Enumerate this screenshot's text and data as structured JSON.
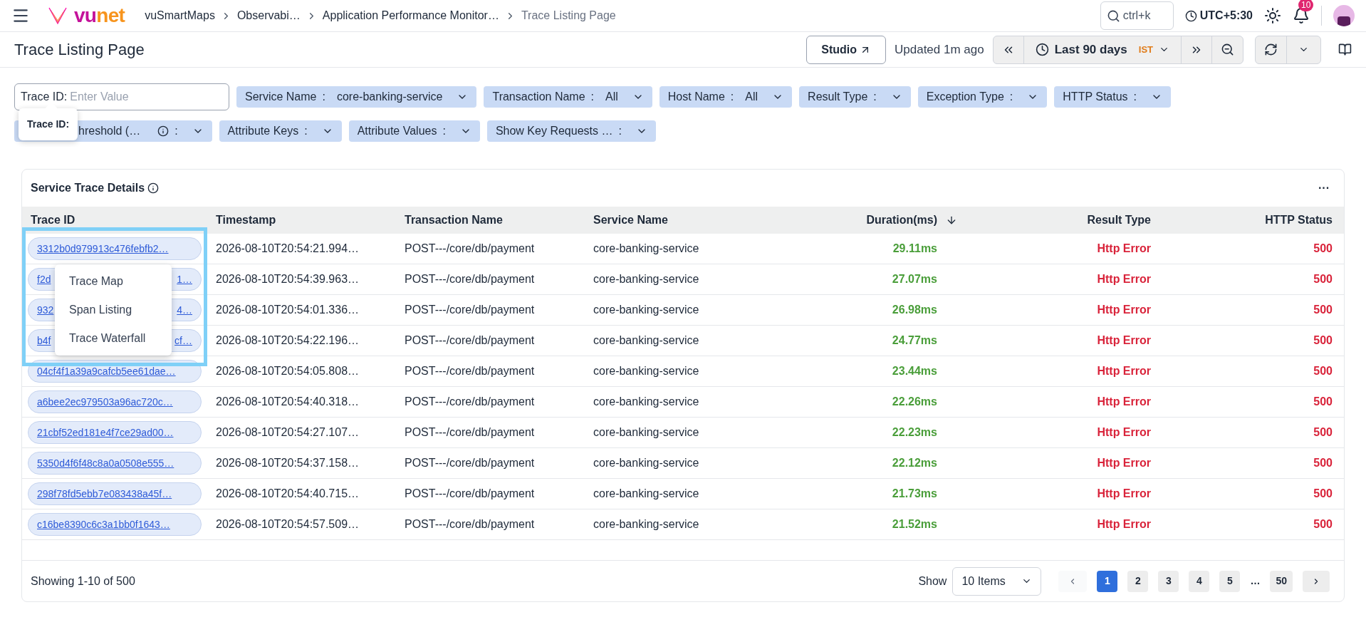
{
  "topbar": {
    "logo": {
      "first": "vu",
      "second": "net"
    },
    "breadcrumbs": [
      {
        "label": "vuSmartMaps",
        "current": false
      },
      {
        "label": "Observabi…",
        "current": false
      },
      {
        "label": "Application Performance Monitor…",
        "current": false
      },
      {
        "label": "Trace Listing Page",
        "current": true
      }
    ],
    "search": {
      "placeholder": "ctrl+k"
    },
    "timezone": "UTC+5:30",
    "notifications": "10"
  },
  "header": {
    "title": "Trace Listing Page",
    "studio": "Studio",
    "updated": "Updated 1m ago",
    "range": "Last 90 days",
    "range_zone": "IST"
  },
  "filters": [
    [
      {
        "kind": "input",
        "label": "Trace ID:",
        "placeholder": "Enter Value"
      },
      {
        "kind": "select",
        "label": "Service Name",
        "separator": ":",
        "value": "core-banking-service"
      },
      {
        "kind": "select",
        "label": "Transaction Name",
        "separator": ":",
        "value": "All"
      },
      {
        "kind": "select",
        "label": "Host Name",
        "separator": ":",
        "value": "All"
      },
      {
        "kind": "select",
        "label": "Result Type",
        "separator": ":"
      },
      {
        "kind": "select",
        "label": "Exception Type",
        "separator": ":"
      },
      {
        "kind": "select",
        "label": "HTTP Status",
        "separator": ":"
      }
    ],
    [
      {
        "kind": "info",
        "label": "hreshold (…",
        "separator": ":"
      },
      {
        "kind": "select",
        "label": "Attribute Keys",
        "separator": ":"
      },
      {
        "kind": "select",
        "label": "Attribute Values",
        "separator": ":"
      },
      {
        "kind": "select",
        "label": "Show Key Requests …",
        "separator": ":"
      }
    ]
  ],
  "tooltip": "Trace ID:",
  "card": {
    "title": "Service Trace Details",
    "more": "···",
    "columns": [
      "Trace ID",
      "Timestamp",
      "Transaction Name",
      "Service Name",
      "Duration(ms)",
      "Result Type",
      "HTTP Status"
    ],
    "rows": [
      {
        "trace_id": "3312b0d979913c476febfb2…",
        "timestamp": "2026-08-10T20:54:21.994…",
        "transaction": "POST---/core/db/payment",
        "service": "core-banking-service",
        "duration": "29.11ms",
        "result": "Http Error",
        "status": "500"
      },
      {
        "trace_id": "f2d",
        "trace_id_end": "1…",
        "timestamp": "2026-08-10T20:54:39.963…",
        "transaction": "POST---/core/db/payment",
        "service": "core-banking-service",
        "duration": "27.07ms",
        "result": "Http Error",
        "status": "500"
      },
      {
        "trace_id": "932",
        "trace_id_end": "4…",
        "timestamp": "2026-08-10T20:54:01.336…",
        "transaction": "POST---/core/db/payment",
        "service": "core-banking-service",
        "duration": "26.98ms",
        "result": "Http Error",
        "status": "500"
      },
      {
        "trace_id": "b4f",
        "trace_id_end": "cf…",
        "timestamp": "2026-08-10T20:54:22.196…",
        "transaction": "POST---/core/db/payment",
        "service": "core-banking-service",
        "duration": "24.77ms",
        "result": "Http Error",
        "status": "500"
      },
      {
        "trace_id": "04cf4f1a39a9cafcb5ee61dae…",
        "timestamp": "2026-08-10T20:54:05.808…",
        "transaction": "POST---/core/db/payment",
        "service": "core-banking-service",
        "duration": "23.44ms",
        "result": "Http Error",
        "status": "500"
      },
      {
        "trace_id": "a6bee2ec979503a96ac720c…",
        "timestamp": "2026-08-10T20:54:40.318…",
        "transaction": "POST---/core/db/payment",
        "service": "core-banking-service",
        "duration": "22.26ms",
        "result": "Http Error",
        "status": "500"
      },
      {
        "trace_id": "21cbf52ed181e4f7ce29ad00…",
        "timestamp": "2026-08-10T20:54:27.107…",
        "transaction": "POST---/core/db/payment",
        "service": "core-banking-service",
        "duration": "22.23ms",
        "result": "Http Error",
        "status": "500"
      },
      {
        "trace_id": "5350d4f6f48c8a0a0508e555…",
        "timestamp": "2026-08-10T20:54:37.158…",
        "transaction": "POST---/core/db/payment",
        "service": "core-banking-service",
        "duration": "22.12ms",
        "result": "Http Error",
        "status": "500"
      },
      {
        "trace_id": "298f78fd5ebb7e083438a45f…",
        "timestamp": "2026-08-10T20:54:40.715…",
        "transaction": "POST---/core/db/payment",
        "service": "core-banking-service",
        "duration": "21.73ms",
        "result": "Http Error",
        "status": "500"
      },
      {
        "trace_id": "c16be8390c6c3a1bb0f1643…",
        "timestamp": "2026-08-10T20:54:57.509…",
        "transaction": "POST---/core/db/payment",
        "service": "core-banking-service",
        "duration": "21.52ms",
        "result": "Http Error",
        "status": "500"
      }
    ],
    "menu": [
      "Trace Map",
      "Span Listing",
      "Trace Waterfall"
    ],
    "footer": {
      "showing": "Showing 1-10 of 500",
      "show": "Show",
      "page_size": "10 Items",
      "pages": [
        {
          "label": "1",
          "selected": true
        },
        {
          "label": "2",
          "selected": false
        },
        {
          "label": "3",
          "selected": false
        },
        {
          "label": "4",
          "selected": false
        },
        {
          "label": "5",
          "selected": false
        },
        {
          "label": "…",
          "kind": "gap"
        },
        {
          "label": "50",
          "selected": false
        }
      ]
    }
  }
}
